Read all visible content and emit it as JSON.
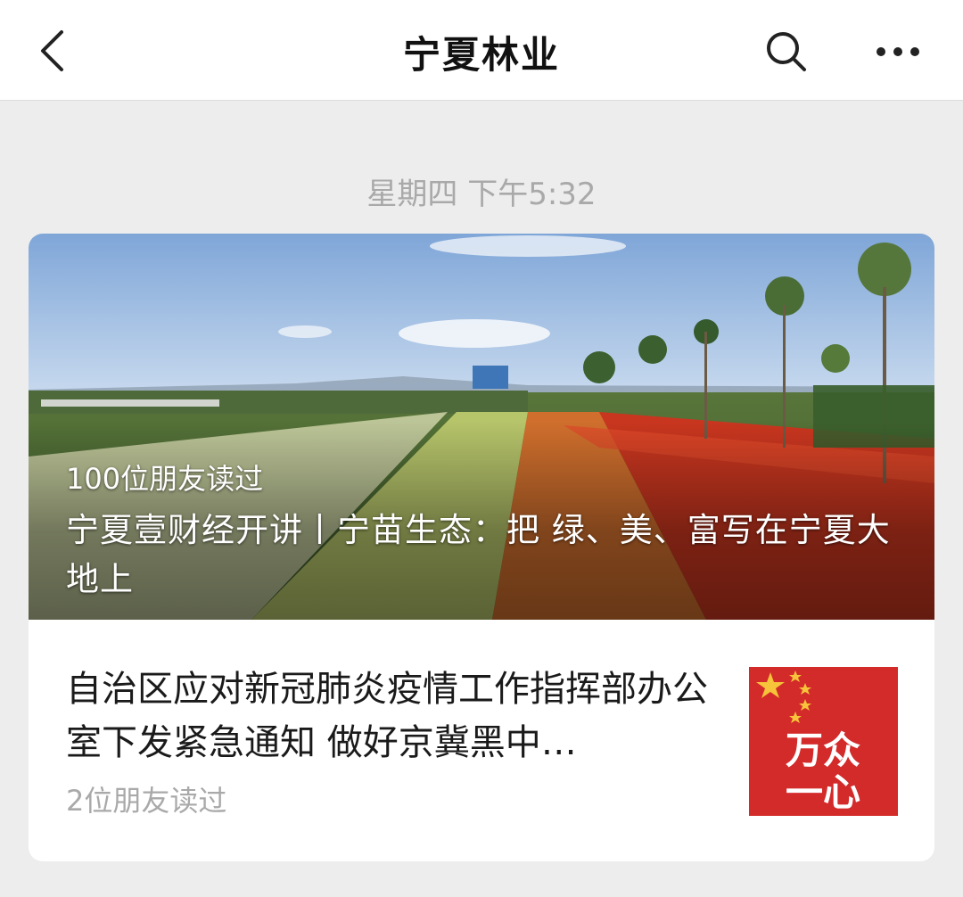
{
  "navbar": {
    "back_icon": "chevron-left-icon",
    "title": "宁夏林业",
    "search_icon": "search-icon",
    "more_icon": "more-dots-icon"
  },
  "timestamp": "星期四 下午5:32",
  "card": {
    "cover": {
      "readers": "100位朋友读过",
      "title": "宁夏壹财经开讲丨宁苗生态：把 绿、美、富写在宁夏大地上"
    },
    "item": {
      "title": "自治区应对新冠肺炎疫情工作指挥部办公室下发紧急通知 做好京冀黑中…",
      "readers": "2位朋友读过",
      "thumb_text": "万众一心"
    }
  },
  "colors": {
    "background": "#ededed",
    "card": "#ffffff",
    "muted_text": "#a9a9a9",
    "thumb_red": "#d32a2a",
    "star_yellow": "#f6c33a"
  }
}
